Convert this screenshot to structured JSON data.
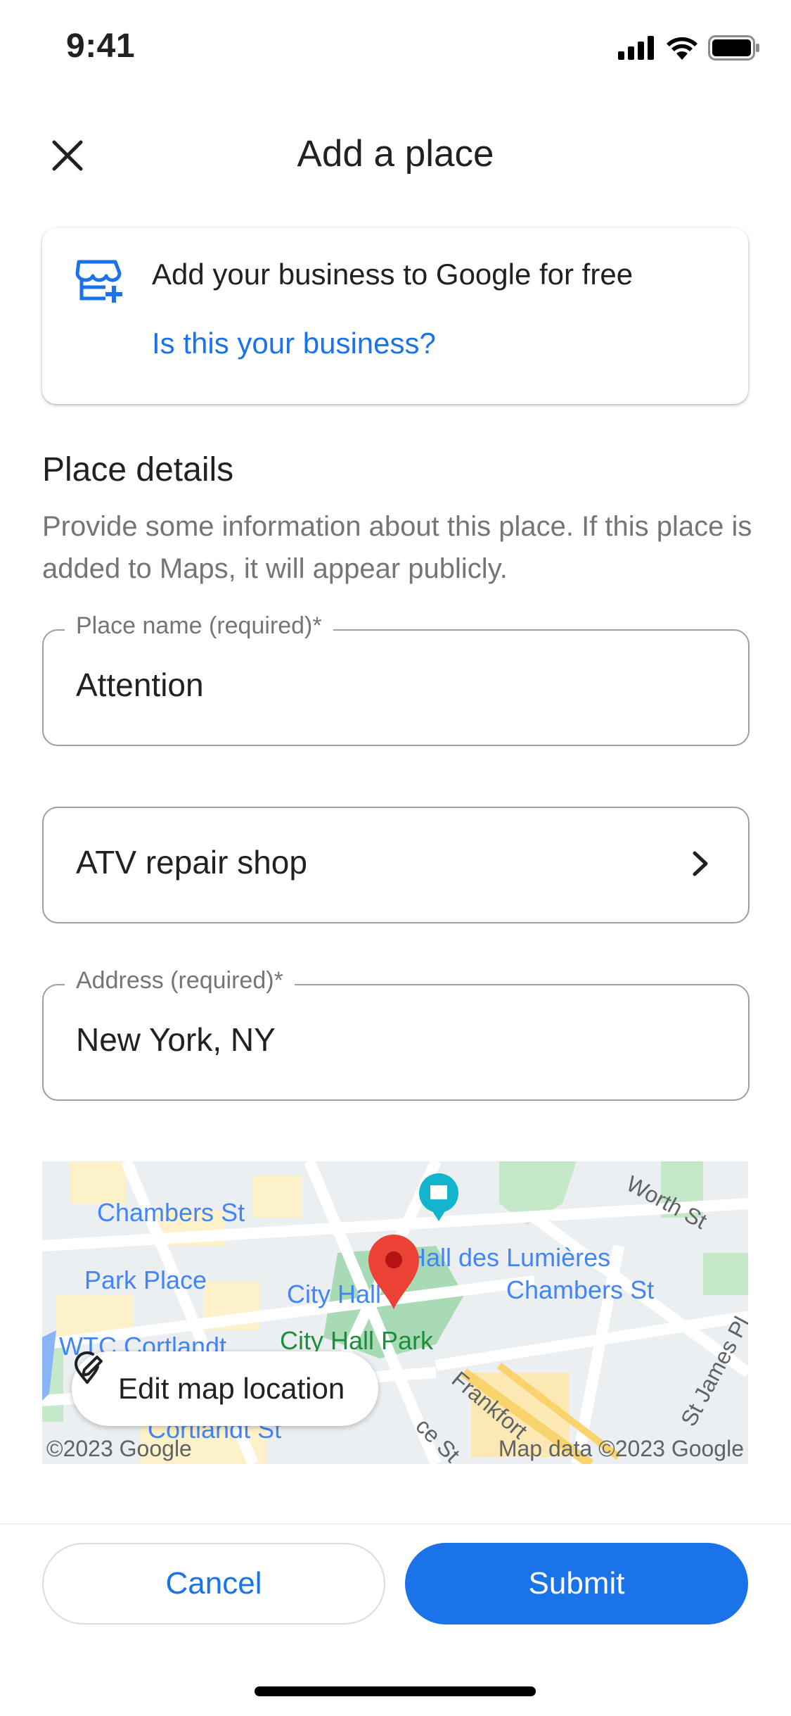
{
  "status_bar": {
    "time": "9:41",
    "signal_icon": "cellular-signal-icon",
    "wifi_icon": "wifi-icon",
    "battery_icon": "battery-icon"
  },
  "header": {
    "title": "Add a place",
    "close_icon": "close-icon"
  },
  "business_card": {
    "icon": "storefront-add-icon",
    "title": "Add your business to Google for free",
    "link": "Is this your business?"
  },
  "details": {
    "title": "Place details",
    "description": "Provide some information about this place. If this place is added to Maps, it will appear publicly."
  },
  "fields": {
    "place_name": {
      "label": "Place name (required)*",
      "value": "Attention"
    },
    "category": {
      "value": "ATV repair shop",
      "chevron_icon": "chevron-right-icon"
    },
    "address": {
      "label": "Address (required)*",
      "value": "New York, NY"
    }
  },
  "map": {
    "labels": {
      "chambers_st_left": "Chambers St",
      "park_place": "Park Place",
      "city_hall": "City Hall",
      "hall_des_lumieres": "Hall des Lumières",
      "chambers_st_right": "Chambers St",
      "wtc_cortlandt": "WTC Cortlandt",
      "city_hall_park": "City Hall Park",
      "cortlandt_st": "Cortlandt St",
      "worth_st": "Worth St",
      "st_james_pl": "St James Pl",
      "frankfort": "Frankfort",
      "ce_st": "ce St"
    },
    "copyright_left": "©2023 Google",
    "copyright_right": "Map data ©2023 Google",
    "edit_button": "Edit map location",
    "edit_icon": "map-pin-edit-icon",
    "pin_icon": "location-pin-icon",
    "pin_color": "#ea4335"
  },
  "actions": {
    "cancel": "Cancel",
    "submit": "Submit"
  },
  "colors": {
    "accent": "#1a73e8",
    "text": "#202124",
    "muted": "#757575"
  }
}
